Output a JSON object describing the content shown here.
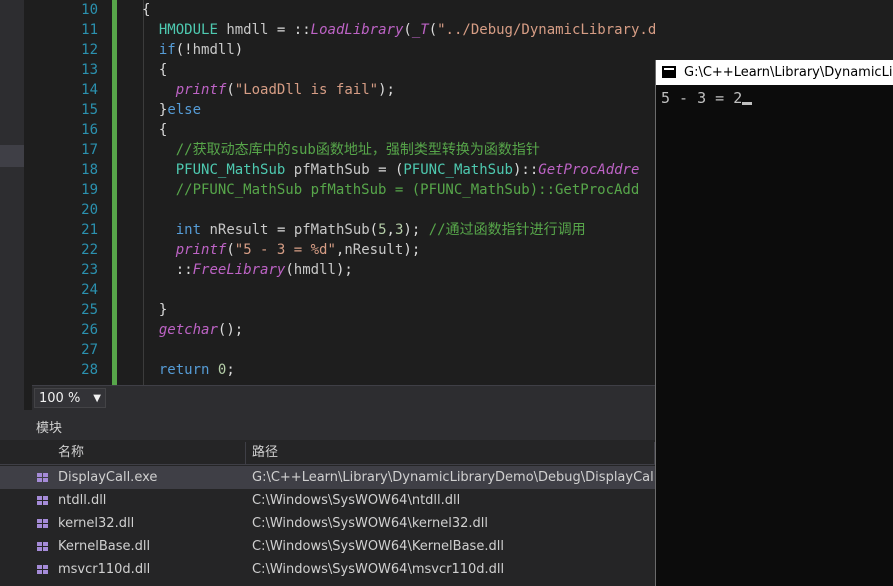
{
  "editor": {
    "lines": [
      {
        "n": "10",
        "t": "{"
      },
      {
        "n": "11",
        "t": "  HMODULE hmdll = ::LoadLibrary(_T(\"../Debug/DynamicLibrary.dll\"));//动态加载dll"
      },
      {
        "n": "12",
        "t": "  if(!hmdll)"
      },
      {
        "n": "13",
        "t": "  {"
      },
      {
        "n": "14",
        "t": "    printf(\"LoadDll is fail\");"
      },
      {
        "n": "15",
        "t": "  }else"
      },
      {
        "n": "16",
        "t": "  {"
      },
      {
        "n": "17",
        "t": "    //获取动态库中的sub函数地址，强制类型转换为函数指针"
      },
      {
        "n": "18",
        "t": "    PFUNC_MathSub pfMathSub = (PFUNC_MathSub)::GetProcAddre"
      },
      {
        "n": "19",
        "t": "    //PFUNC_MathSub pfMathSub = (PFUNC_MathSub)::GetProcAdd"
      },
      {
        "n": "20",
        "t": ""
      },
      {
        "n": "21",
        "t": "    int nResult = pfMathSub(5,3); //通过函数指针进行调用"
      },
      {
        "n": "22",
        "t": "    printf(\"5 - 3 = %d\",nResult);"
      },
      {
        "n": "23",
        "t": "    ::FreeLibrary(hmdll);"
      },
      {
        "n": "24",
        "t": ""
      },
      {
        "n": "25",
        "t": "  }"
      },
      {
        "n": "26",
        "t": "  getchar();"
      },
      {
        "n": "27",
        "t": ""
      },
      {
        "n": "28",
        "t": "  return 0;"
      }
    ]
  },
  "zoom": {
    "value": "100 %"
  },
  "modules": {
    "title": "模块",
    "columns": {
      "name": "名称",
      "path": "路径"
    },
    "rows": [
      {
        "name": "DisplayCall.exe",
        "path": "G:\\C++Learn\\Library\\DynamicLibraryDemo\\Debug\\DisplayCall.exe"
      },
      {
        "name": "ntdll.dll",
        "path": "C:\\Windows\\SysWOW64\\ntdll.dll"
      },
      {
        "name": "kernel32.dll",
        "path": "C:\\Windows\\SysWOW64\\kernel32.dll"
      },
      {
        "name": "KernelBase.dll",
        "path": "C:\\Windows\\SysWOW64\\KernelBase.dll"
      },
      {
        "name": "msvcr110d.dll",
        "path": "C:\\Windows\\SysWOW64\\msvcr110d.dll"
      }
    ]
  },
  "console": {
    "title": "G:\\C++Learn\\Library\\DynamicLibr",
    "output": "5 - 3 = 2"
  },
  "colors": {
    "keyword": "#569cd6",
    "comment": "#57a64a",
    "string": "#d69d85",
    "line_number": "#2b91af",
    "background": "#1e1e1e"
  }
}
